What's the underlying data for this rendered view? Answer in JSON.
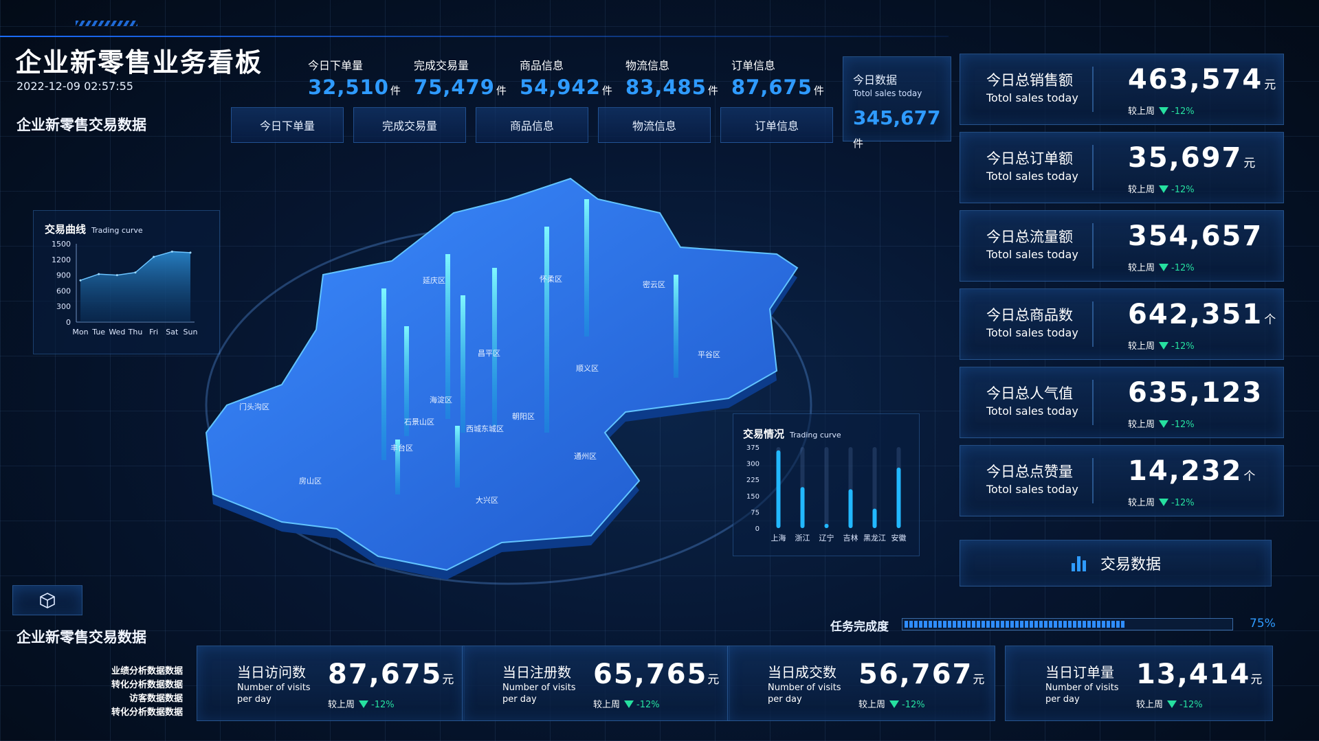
{
  "header": {
    "title": "企业新零售业务看板",
    "datetime": "2022-12-09 02:57:55",
    "section_left": "企业新零售交易数据",
    "stats": [
      {
        "label": "今日下单量",
        "value": "32,510",
        "unit": "件"
      },
      {
        "label": "完成交易量",
        "value": "75,479",
        "unit": "件"
      },
      {
        "label": "商品信息",
        "value": "54,942",
        "unit": "件"
      },
      {
        "label": "物流信息",
        "value": "83,485",
        "unit": "件"
      },
      {
        "label": "订单信息",
        "value": "87,675",
        "unit": "件"
      }
    ],
    "today": {
      "title": "今日数据",
      "subtitle": "Totol sales today",
      "value": "345,677",
      "unit": "件"
    },
    "tabs": [
      "今日下单量",
      "完成交易量",
      "商品信息",
      "物流信息",
      "订单信息"
    ]
  },
  "kpis": [
    {
      "title": "今日总销售额",
      "sub": "Totol sales today",
      "value": "463,574",
      "unit": "元",
      "cmp_label": "较上周",
      "cmp_value": "-12%"
    },
    {
      "title": "今日总订单额",
      "sub": "Totol sales today",
      "value": "35,697",
      "unit": "元",
      "cmp_label": "较上周",
      "cmp_value": "-12%"
    },
    {
      "title": "今日总流量额",
      "sub": "Totol sales today",
      "value": "354,657",
      "unit": "",
      "cmp_label": "较上周",
      "cmp_value": "-12%"
    },
    {
      "title": "今日总商品数",
      "sub": "Totol sales today",
      "value": "642,351",
      "unit": "个",
      "cmp_label": "较上周",
      "cmp_value": "-12%"
    },
    {
      "title": "今日总人气值",
      "sub": "Totol sales today",
      "value": "635,123",
      "unit": "",
      "cmp_label": "较上周",
      "cmp_value": "-12%"
    },
    {
      "title": "今日总点赞量",
      "sub": "Totol sales today",
      "value": "14,232",
      "unit": "个",
      "cmp_label": "较上周",
      "cmp_value": "-12%"
    }
  ],
  "trade_button": {
    "label": "交易数据"
  },
  "progress": {
    "label": "任务完成度",
    "value_text": "75%",
    "fraction": 0.75
  },
  "bottom": {
    "section_title": "企业新零售交易数据",
    "list": [
      "业绩分析数据数据",
      "转化分析数据数据",
      "访客数据数据",
      "转化分析数据数据"
    ],
    "cards": [
      {
        "title": "当日访问数",
        "sub": "Number of visits per day",
        "value": "87,675",
        "unit": "元",
        "cmp_label": "较上周",
        "cmp_value": "-12%"
      },
      {
        "title": "当日注册数",
        "sub": "Number of visits per day",
        "value": "65,765",
        "unit": "元",
        "cmp_label": "较上周",
        "cmp_value": "-12%"
      },
      {
        "title": "当日成交数",
        "sub": "Number of visits per day",
        "value": "56,767",
        "unit": "元",
        "cmp_label": "较上周",
        "cmp_value": "-12%"
      },
      {
        "title": "当日订单量",
        "sub": "Number of visits per day",
        "value": "13,414",
        "unit": "元",
        "cmp_label": "较上周",
        "cmp_value": "-12%"
      }
    ]
  },
  "map": {
    "districts": [
      "延庆区",
      "怀柔区",
      "密云区",
      "昌平区",
      "平谷区",
      "顺义区",
      "门头沟区",
      "海淀区",
      "石景山区",
      "西城东城区",
      "朝阳区",
      "丰台区",
      "通州区",
      "房山区",
      "大兴区"
    ]
  },
  "colors": {
    "accent": "#2f9bff",
    "down": "#26e0a0",
    "bar": "#22b8ff"
  },
  "icons": {
    "cube": "cube-icon",
    "bar_chart": "bar-chart-icon"
  },
  "chart_data": [
    {
      "type": "area",
      "title": "交易曲线",
      "subtitle": "Trading curve",
      "categories": [
        "Mon",
        "Tue",
        "Wed",
        "Thu",
        "Fri",
        "Sat",
        "Sun"
      ],
      "values": [
        800,
        920,
        900,
        950,
        1250,
        1350,
        1330
      ],
      "yticks": [
        0,
        300,
        600,
        900,
        1200,
        1500
      ],
      "ylim": [
        0,
        1500
      ],
      "grid": false
    },
    {
      "type": "bar",
      "title": "交易情况",
      "subtitle": "Trading curve",
      "categories": [
        "上海",
        "浙江",
        "辽宁",
        "吉林",
        "黑龙江",
        "安徽"
      ],
      "values": [
        360,
        190,
        20,
        180,
        90,
        280
      ],
      "yticks": [
        0,
        75,
        150,
        225,
        300,
        375
      ],
      "ylim": [
        0,
        375
      ],
      "grid": false
    }
  ]
}
